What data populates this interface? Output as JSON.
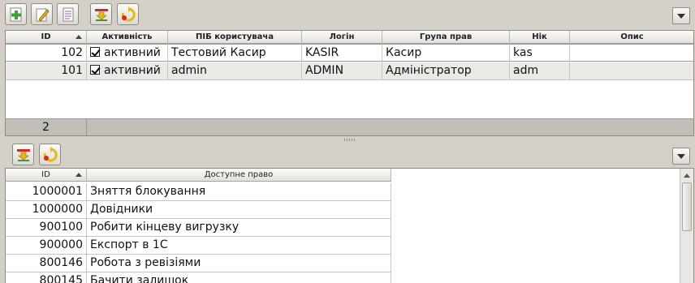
{
  "top_toolbar": {
    "buttons": [
      {
        "name": "add-user-button",
        "icon": "add-icon"
      },
      {
        "name": "edit-user-button",
        "icon": "pencil-icon"
      },
      {
        "name": "view-doc-button",
        "icon": "document-icon"
      },
      {
        "name": "export-button",
        "icon": "export-icon"
      },
      {
        "name": "refresh-button",
        "icon": "refresh-icon"
      }
    ]
  },
  "users_table": {
    "columns": [
      "ID",
      "Активність",
      "ПІБ користувача",
      "Логін",
      "Група прав",
      "Нік",
      "Опис"
    ],
    "rows": [
      {
        "id": "102",
        "active": "активний",
        "name": "Тестовий Касир",
        "login": "KASIR",
        "group": "Касир",
        "nick": "kas",
        "desc": ""
      },
      {
        "id": "101",
        "active": "активний",
        "name": "admin",
        "login": "ADMIN",
        "group": "Адміністратор",
        "nick": "adm",
        "desc": ""
      }
    ],
    "footer_count": "2"
  },
  "rights_table": {
    "columns": [
      "ID",
      "Доступне право"
    ],
    "rows": [
      {
        "id": "1000001",
        "right": "Зняття блокування"
      },
      {
        "id": "1000000",
        "right": "Довідники"
      },
      {
        "id": "900100",
        "right": "Робити кінцеву вигрузку"
      },
      {
        "id": "900000",
        "right": "Експорт в 1С"
      },
      {
        "id": "800146",
        "right": "Робота з ревізіями"
      },
      {
        "id": "800145",
        "right": "Бачити залишок"
      }
    ]
  },
  "colors": {
    "accent_green": "#3aa52e",
    "accent_red": "#d22a1e",
    "icon_yellow": "#e8b51a"
  }
}
